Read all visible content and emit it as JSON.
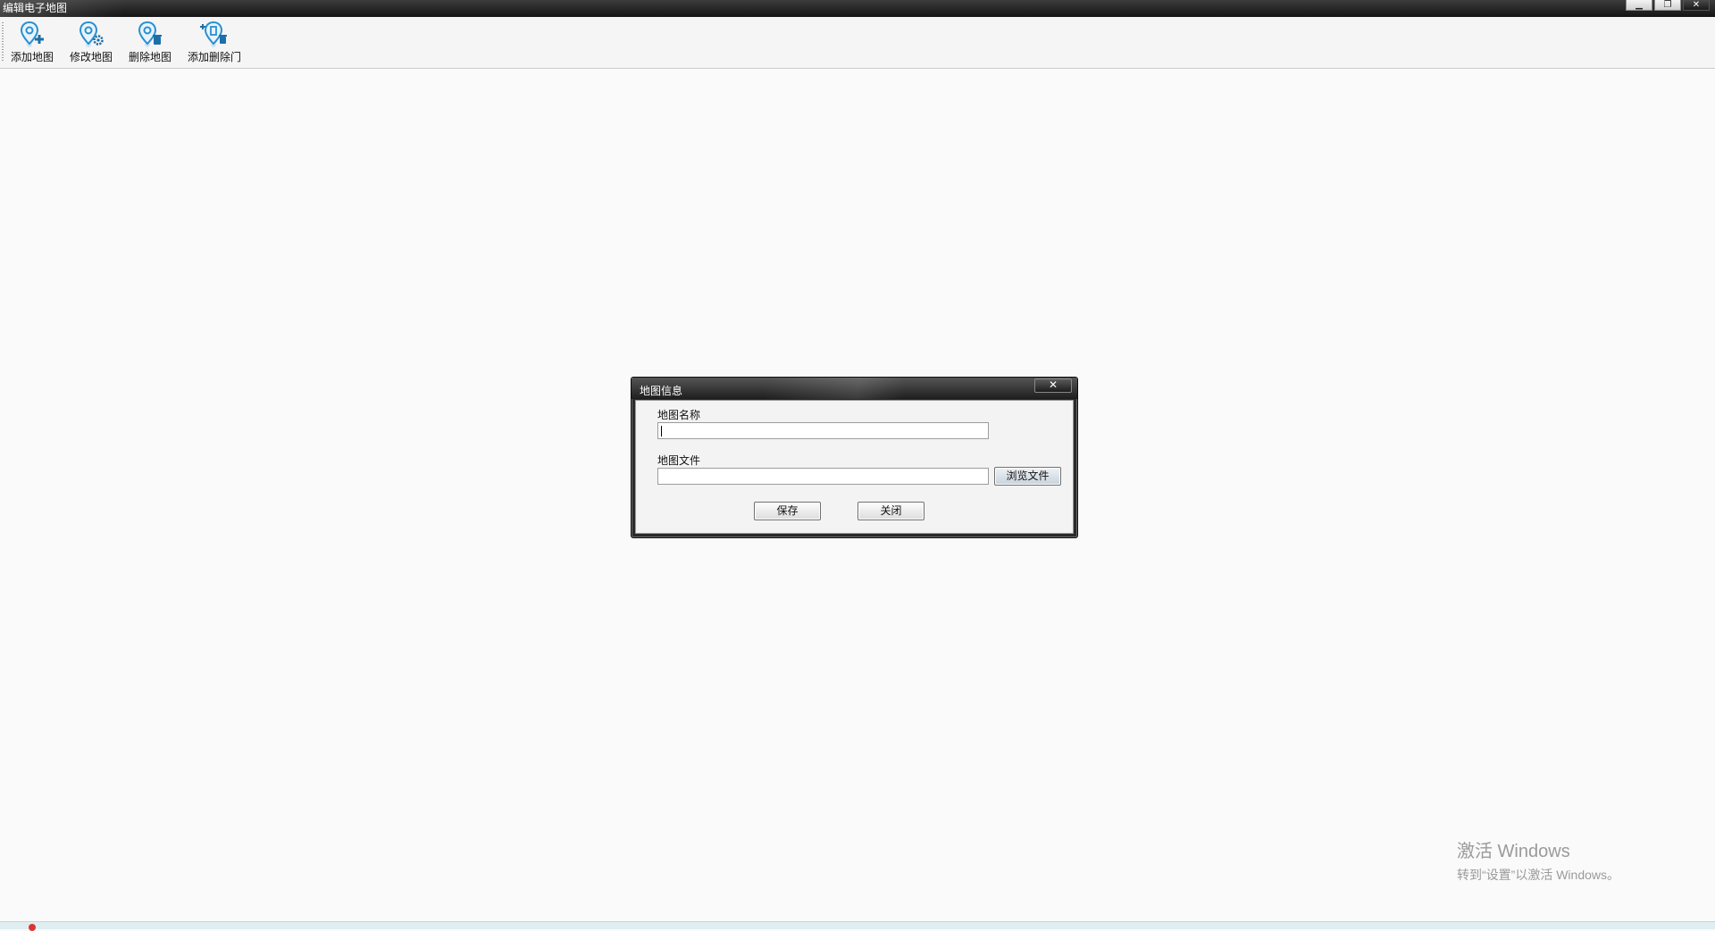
{
  "window": {
    "title": "编辑电子地图",
    "minimize_glyph": "▁",
    "restore_glyph": "❐",
    "close_glyph": "✕"
  },
  "toolbar": {
    "items": [
      {
        "label": "添加地图",
        "icon": "map-pin-add-icon"
      },
      {
        "label": "修改地图",
        "icon": "map-pin-settings-icon"
      },
      {
        "label": "删除地图",
        "icon": "map-pin-delete-icon"
      },
      {
        "label": "添加删除门",
        "icon": "door-edit-icon"
      }
    ]
  },
  "dialog": {
    "title": "地图信息",
    "close_glyph": "✕",
    "map_name_label": "地图名称",
    "map_name_value": "",
    "map_file_label": "地图文件",
    "map_file_value": "",
    "browse_label": "浏览文件",
    "save_label": "保存",
    "close_label": "关闭"
  },
  "watermark": {
    "line1": "激活 Windows",
    "line2": "转到“设置”以激活 Windows。"
  },
  "colors": {
    "icon_blue": "#2a8fd0",
    "titlebar": "#1e1e1e"
  }
}
